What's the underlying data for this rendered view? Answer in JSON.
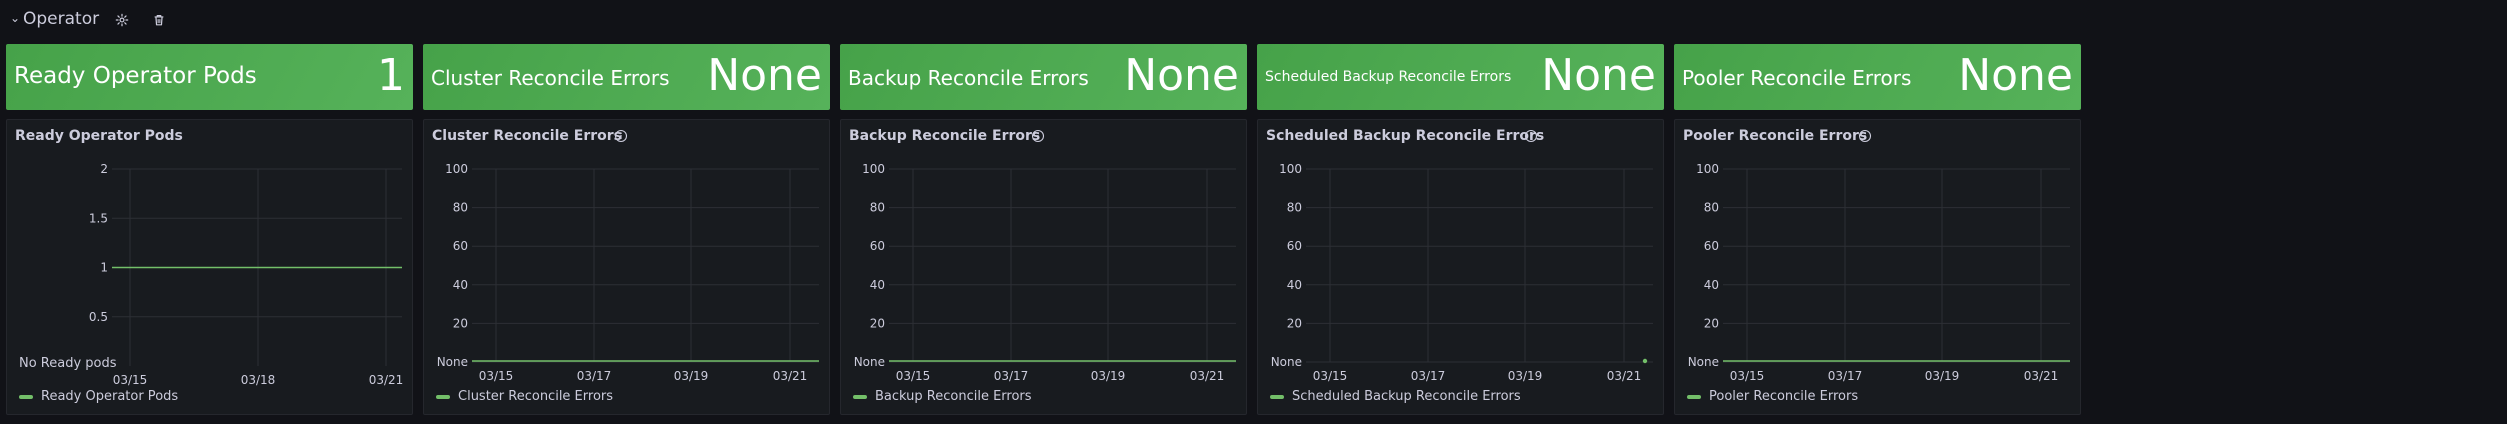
{
  "row": {
    "title": "Operator",
    "chevron": "⌄",
    "settings_icon": "gear-icon",
    "delete_icon": "trash-icon"
  },
  "colors": {
    "background": "#111217",
    "panel": "#181b1f",
    "stat_green": "#56b25a",
    "series": "#73bf69",
    "grid": "#2c2f35"
  },
  "stats": [
    {
      "title": "Ready Operator Pods",
      "value": "1"
    },
    {
      "title": "Cluster Reconcile Errors",
      "value": "None"
    },
    {
      "title": "Backup Reconcile Errors",
      "value": "None"
    },
    {
      "title": "Scheduled Backup Reconcile Errors",
      "value": "None"
    },
    {
      "title": "Pooler Reconcile Errors",
      "value": "None"
    }
  ],
  "panels": [
    {
      "title": "Ready Operator Pods",
      "legend": "Ready Operator Pods",
      "extra_text": "No Ready pods",
      "info": false
    },
    {
      "title": "Cluster Reconcile Errors",
      "legend": "Cluster Reconcile Errors",
      "info": true
    },
    {
      "title": "Backup Reconcile Errors",
      "legend": "Backup Reconcile Errors",
      "info": true
    },
    {
      "title": "Scheduled Backup Reconcile Errors",
      "legend": "Scheduled Backup Reconcile Errors",
      "info": true
    },
    {
      "title": "Pooler Reconcile Errors",
      "legend": "Pooler Reconcile Errors",
      "info": true
    }
  ],
  "chart_data": [
    {
      "type": "line",
      "title": "Ready Operator Pods",
      "ylim": [
        0,
        2
      ],
      "y_ticks": [
        "2",
        "1.5",
        "1",
        "0.5"
      ],
      "x_ticks": [
        "03/15",
        "03/18",
        "03/21"
      ],
      "grid": true,
      "legend_position": "bottom-left",
      "series": [
        {
          "name": "Ready Operator Pods",
          "x": [
            "03/15",
            "03/21"
          ],
          "values": [
            1,
            1
          ]
        }
      ]
    },
    {
      "type": "line",
      "title": "Cluster Reconcile Errors",
      "ylim": [
        0,
        100
      ],
      "y_ticks": [
        "100",
        "80",
        "60",
        "40",
        "20",
        "None"
      ],
      "x_ticks": [
        "03/15",
        "03/17",
        "03/19",
        "03/21"
      ],
      "grid": true,
      "legend_position": "bottom-left",
      "series": [
        {
          "name": "Cluster Reconcile Errors",
          "x": [
            "03/15",
            "03/21"
          ],
          "values": [
            0,
            0
          ]
        }
      ]
    },
    {
      "type": "line",
      "title": "Backup Reconcile Errors",
      "ylim": [
        0,
        100
      ],
      "y_ticks": [
        "100",
        "80",
        "60",
        "40",
        "20",
        "None"
      ],
      "x_ticks": [
        "03/15",
        "03/17",
        "03/19",
        "03/21"
      ],
      "grid": true,
      "legend_position": "bottom-left",
      "series": [
        {
          "name": "Backup Reconcile Errors",
          "x": [
            "03/15",
            "03/21"
          ],
          "values": [
            0,
            0
          ]
        }
      ]
    },
    {
      "type": "scatter",
      "title": "Scheduled Backup Reconcile Errors",
      "ylim": [
        0,
        100
      ],
      "y_ticks": [
        "100",
        "80",
        "60",
        "40",
        "20",
        "None"
      ],
      "x_ticks": [
        "03/15",
        "03/17",
        "03/19",
        "03/21"
      ],
      "grid": true,
      "legend_position": "bottom-left",
      "series": [
        {
          "name": "Scheduled Backup Reconcile Errors",
          "x": [
            "03/21"
          ],
          "values": [
            0
          ]
        }
      ]
    },
    {
      "type": "line",
      "title": "Pooler Reconcile Errors",
      "ylim": [
        0,
        100
      ],
      "y_ticks": [
        "100",
        "80",
        "60",
        "40",
        "20",
        "None"
      ],
      "x_ticks": [
        "03/15",
        "03/17",
        "03/19",
        "03/21"
      ],
      "grid": true,
      "legend_position": "bottom-left",
      "series": [
        {
          "name": "Pooler Reconcile Errors",
          "x": [
            "03/15",
            "03/21"
          ],
          "values": [
            0,
            0
          ]
        }
      ]
    }
  ]
}
